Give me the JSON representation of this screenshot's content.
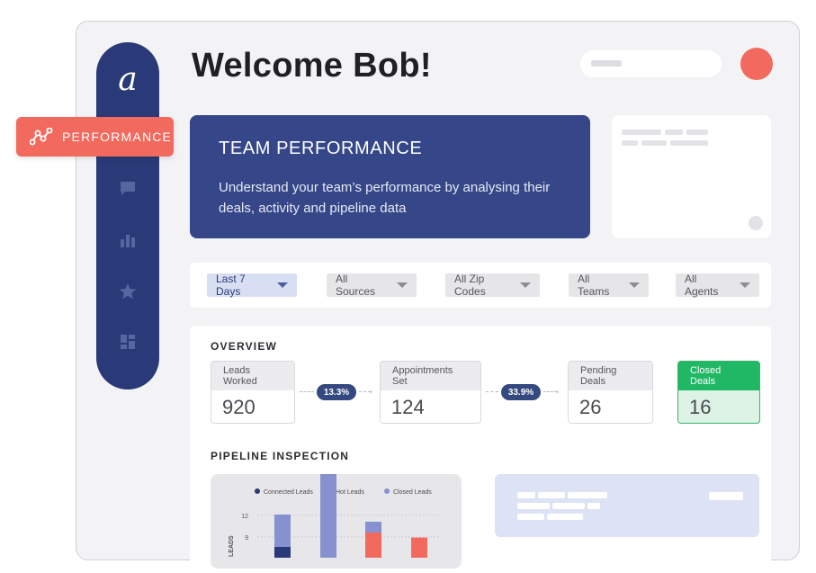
{
  "header": {
    "welcome": "Welcome Bob!"
  },
  "sidebar": {
    "logo": "a",
    "active_item": {
      "label": "PERFORMANCE",
      "icon": "performance-graph-icon"
    },
    "items": [
      {
        "icon": "chat-bubble-icon"
      },
      {
        "icon": "bar-chart-icon"
      },
      {
        "icon": "star-icon"
      },
      {
        "icon": "dashboard-layout-icon"
      }
    ]
  },
  "team_card": {
    "title": "TEAM PERFORMANCE",
    "description": "Understand your team’s performance by analysing their deals, activity and pipeline data"
  },
  "filters": [
    {
      "label": "Last 7 Days"
    },
    {
      "label": "All Sources"
    },
    {
      "label": "All Zip Codes"
    },
    {
      "label": "All Teams"
    },
    {
      "label": "All Agents"
    }
  ],
  "overview": {
    "title": "OVERVIEW",
    "metrics": [
      {
        "label": "Leads Worked",
        "value": "920"
      },
      {
        "label": "Appointments Set",
        "value": "124"
      },
      {
        "label": "Pending Deals",
        "value": "26"
      },
      {
        "label": "Closed Deals",
        "value": "16"
      }
    ],
    "rates": [
      "13.3%",
      "33.9%"
    ]
  },
  "pipeline": {
    "title": "PIPELINE INSPECTION"
  },
  "colors": {
    "navy": "#2a3a78",
    "coral": "#f26a5d",
    "green": "#20b765",
    "card_blue": "#354788"
  },
  "chart_data": {
    "type": "bar",
    "ylabel": "LEADS",
    "yticks": [
      12,
      9
    ],
    "series": [
      {
        "name": "Connected Leads",
        "color": "#2a3a78",
        "values": [
          1.5,
          0,
          0,
          0
        ]
      },
      {
        "name": "Hot Leads",
        "color": "#f26a5d",
        "values": [
          0,
          0,
          3.5,
          2.8
        ]
      },
      {
        "name": "Closed Leads",
        "color": "#8791cf",
        "values": [
          4.5,
          13,
          1.5,
          0
        ]
      }
    ]
  }
}
